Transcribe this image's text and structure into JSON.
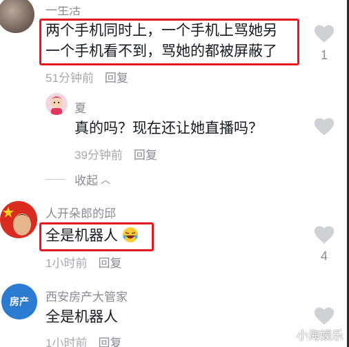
{
  "comments": [
    {
      "username": "一生活",
      "content": [
        "两个手机同时上，一个手机上骂她另",
        "一个手机看不到，骂她的都被屏蔽了"
      ],
      "time": "51分钟前",
      "reply_label": "回复",
      "likes": "1"
    },
    {
      "username": "夏",
      "content": [
        "真的吗？现在还让她直播吗？"
      ],
      "time": "39分钟前",
      "reply_label": "回复"
    },
    {
      "username": "人开朵郎的邱",
      "content": [
        "全是机器人"
      ],
      "time": "1小时前",
      "reply_label": "回复",
      "likes": "4"
    },
    {
      "username": "西安房产大管家",
      "content": [
        "全是机器人"
      ],
      "time": "1小时前",
      "reply_label": "回复"
    }
  ],
  "collapse_label": "收起",
  "avatar_badge_text": "房产",
  "watermark": "小海娱乐",
  "colors": {
    "highlight": "#e8141e",
    "text": "#161823",
    "meta": "#a8a9ae",
    "like_icon": "#d0d1d4"
  },
  "icons": [
    "heart-icon",
    "chevron-up-icon",
    "laughing-emoji-icon"
  ]
}
